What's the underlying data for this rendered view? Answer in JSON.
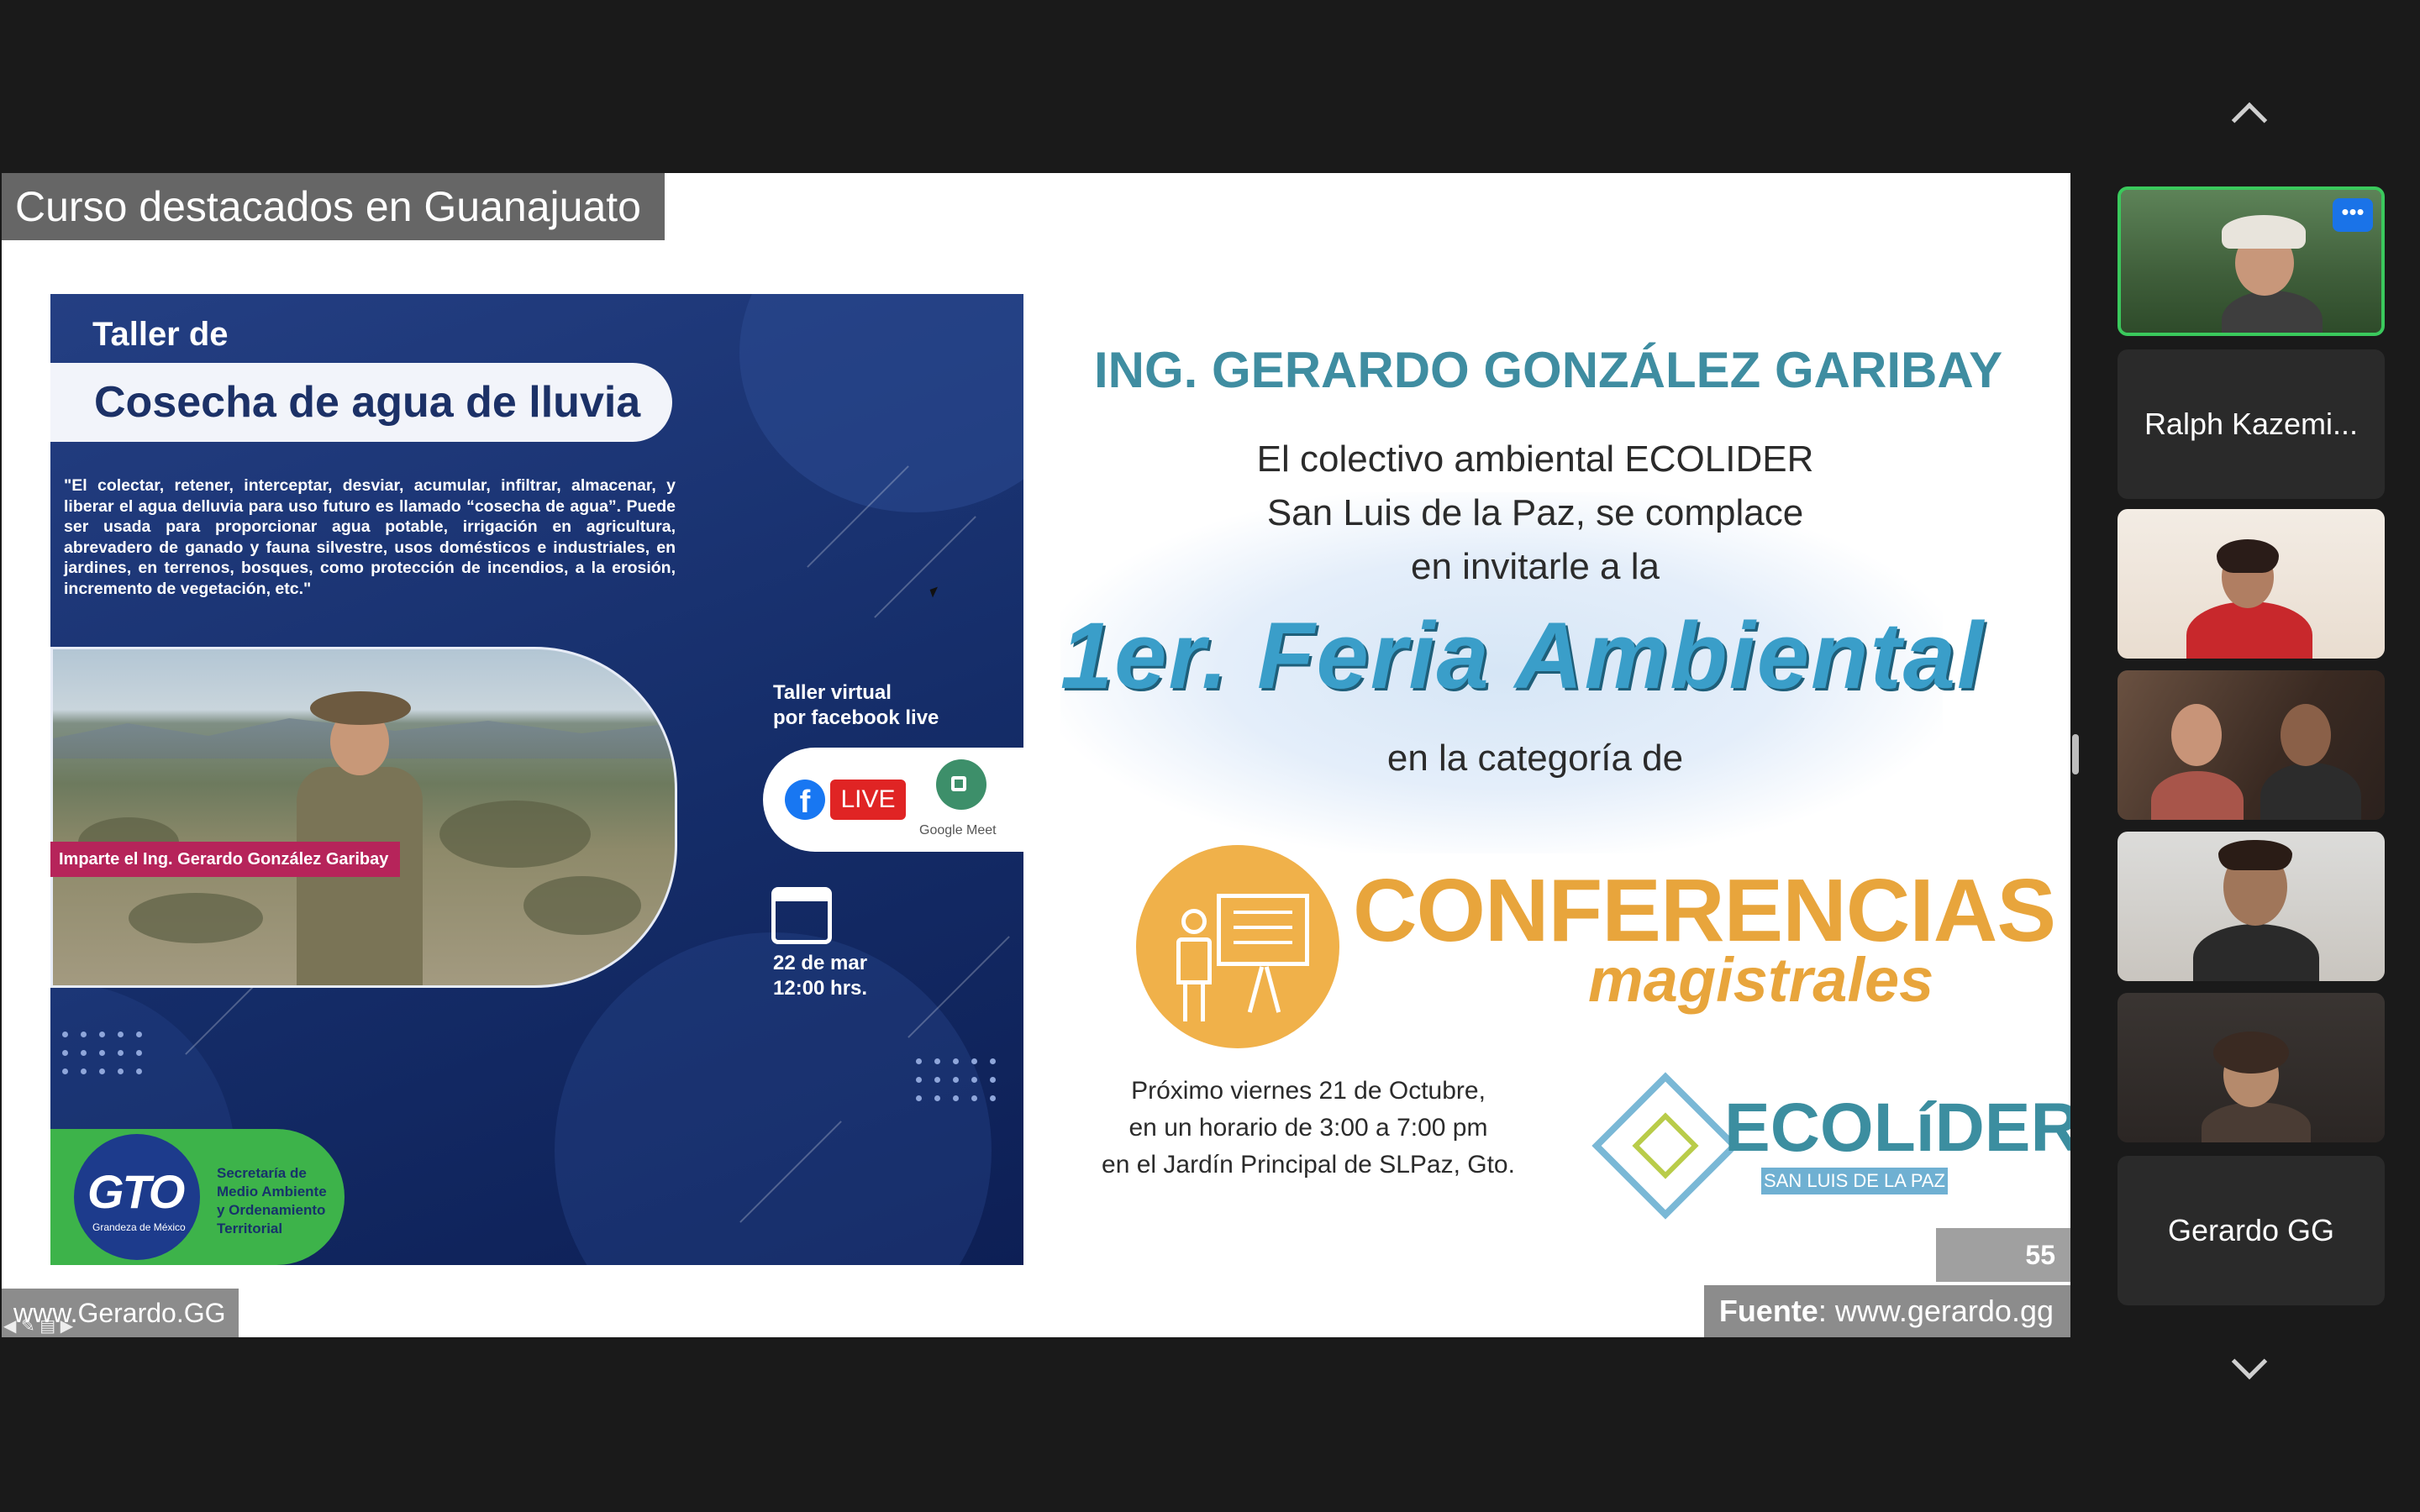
{
  "slide": {
    "title": "Curso destacados en Guanajuato",
    "flyer": {
      "kicker": "Taller de",
      "title": "Cosecha de agua de lluvia",
      "quote": "\"El colectar, retener, interceptar, desviar, acumular, infiltrar, almacenar, y liberar el agua delluvia para uso futuro es llamado “cosecha de agua”. Puede ser usada para proporcionar agua potable, irrigación en agricultura, abrevadero de ganado y fauna silvestre, usos domésticos e industriales, en jardines, en terrenos, bosques, como protección de incendios, a la erosión, incremento de vegetación, etc.\"",
      "imparte": "Imparte el Ing. Gerardo González Garibay",
      "virtual_line1": "Taller virtual",
      "virtual_line2": "por facebook live",
      "live_label": "LIVE",
      "gmeet_label": "Google Meet",
      "date_line1": "22 de mar",
      "date_line2": "12:00  hrs.",
      "gto_logo": "GTO",
      "gto_sub": "Grandeza de México",
      "gto_sec_line1": "Secretaría de",
      "gto_sec_line2": "Medio Ambiente",
      "gto_sec_line3": "y Ordenamiento",
      "gto_sec_line4": "Territorial"
    },
    "invite": {
      "name": "ING. GERARDO GONZÁLEZ GARIBAY",
      "line1": "El colectivo ambiental ECOLIDER",
      "line2": "San Luis de la Paz, se complace",
      "line3": "en invitarle  a la",
      "feria": "1er. Feria Ambiental",
      "categoria": "en la categoría de",
      "conferencias": "CONFERENCIAS",
      "magistrales": "magistrales",
      "prox_line1": "Próximo viernes 21 de Octubre,",
      "prox_line2": "en un horario de 3:00 a 7:00 pm",
      "prox_line3": "en el Jardín Principal de SLPaz, Gto.",
      "eco_name": "ECOLíDER",
      "eco_sub": "SAN LUIS DE LA PAZ"
    },
    "page_number": "55",
    "fuente_label": "Fuente",
    "fuente_value": ": www.gerardo.gg",
    "url": "www.Gerardo.GG"
  },
  "participants": [
    {
      "name": "",
      "video": true,
      "active_speaker": true,
      "more_label": "•••"
    },
    {
      "name": "Ralph Kazemi...",
      "video": false
    },
    {
      "name": "",
      "video": true
    },
    {
      "name": "",
      "video": true
    },
    {
      "name": "",
      "video": true
    },
    {
      "name": "",
      "video": true
    },
    {
      "name": "Gerardo GG",
      "video": false
    }
  ],
  "colors": {
    "active_speaker_border": "#3ac95c",
    "more_button": "#1a73e8",
    "conferencias": "#e8a53c",
    "feria": "#3a9ec9",
    "ecolider": "#3c8ea0"
  }
}
